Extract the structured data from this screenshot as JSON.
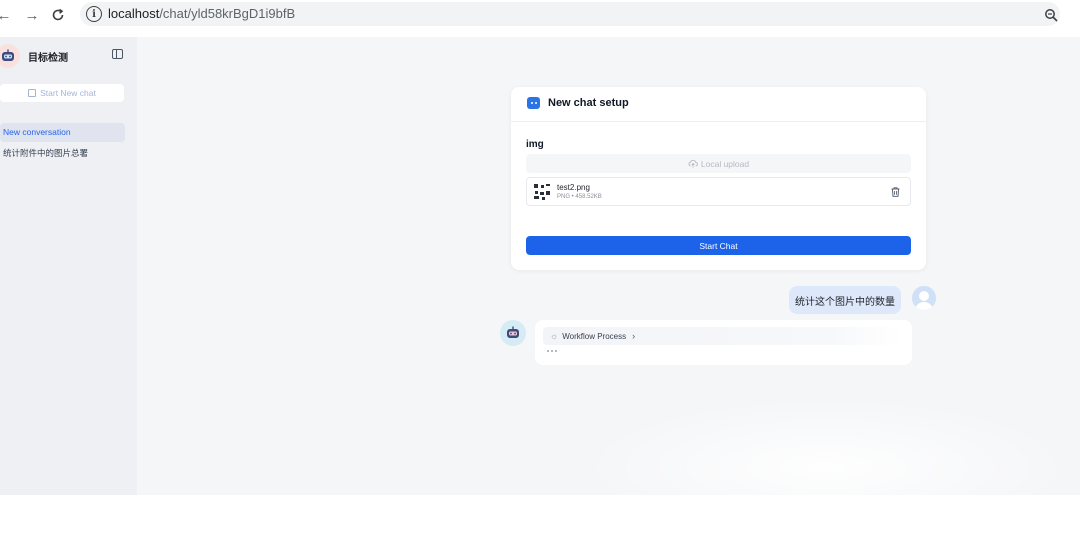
{
  "browser": {
    "url_host": "localhost",
    "url_path": "/chat/yld58krBgD1i9bfB"
  },
  "sidebar": {
    "app_title": "目标检测",
    "start_new_chat": "Start New chat",
    "conversations": [
      {
        "label": "New conversation",
        "active": true
      },
      {
        "label": "统计附件中的图片总署",
        "active": false
      }
    ]
  },
  "setup_card": {
    "title": "New chat setup",
    "field_label": "img",
    "upload_label": "Local upload",
    "file": {
      "name": "test2.png",
      "meta": "PNG • 458.52KB"
    },
    "start_button": "Start Chat"
  },
  "messages": {
    "user_text": "统计这个图片中的数量",
    "workflow_label": "Workflow Process"
  },
  "colors": {
    "accent": "#1c63ea",
    "sidebar_bg": "#eef0f4",
    "main_bg": "#f5f6f8",
    "user_bubble": "#dde8fb"
  },
  "icons": {
    "back": "arrow-left-icon",
    "forward": "arrow-right-icon",
    "reload": "reload-icon",
    "site_info": "info-icon",
    "zoom": "zoom-icon",
    "sidebar_toggle": "sidebar-toggle-icon",
    "edit": "edit-icon",
    "cloud": "cloud-upload-icon",
    "trash": "trash-icon",
    "workflow": "spinner-icon",
    "chevron": "chevron-right-icon"
  }
}
